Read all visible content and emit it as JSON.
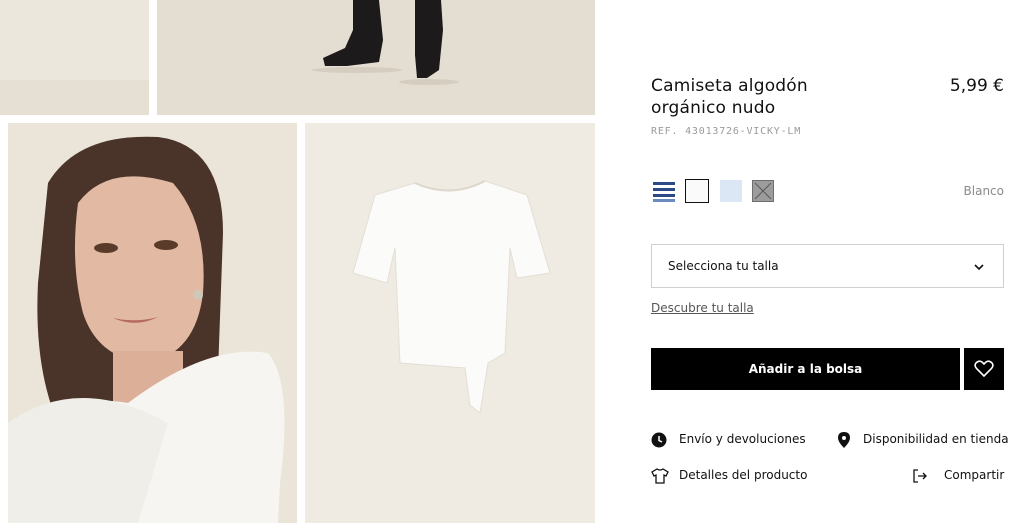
{
  "product": {
    "title_line1": "Camiseta algodón",
    "title_line2": "orgánico nudo",
    "price": "5,99 €",
    "ref": "REF. 43013726-VICKY-LM"
  },
  "colors": {
    "swatches": [
      "navy-stripe-swatch",
      "white-swatch",
      "light-blue-swatch",
      "grey-swatch"
    ],
    "selected_name": "Blanco",
    "accent": "#000000"
  },
  "size": {
    "select_label": "Selecciona tu talla",
    "guide_link": "Descubre tu talla"
  },
  "actions": {
    "add_to_bag": "Añadir a la bolsa",
    "wishlist_icon": "heart-icon"
  },
  "links": {
    "shipping": "Envío y devoluciones",
    "store_availability": "Disponibilidad en tienda",
    "product_details": "Detalles del producto",
    "share": "Compartir"
  }
}
